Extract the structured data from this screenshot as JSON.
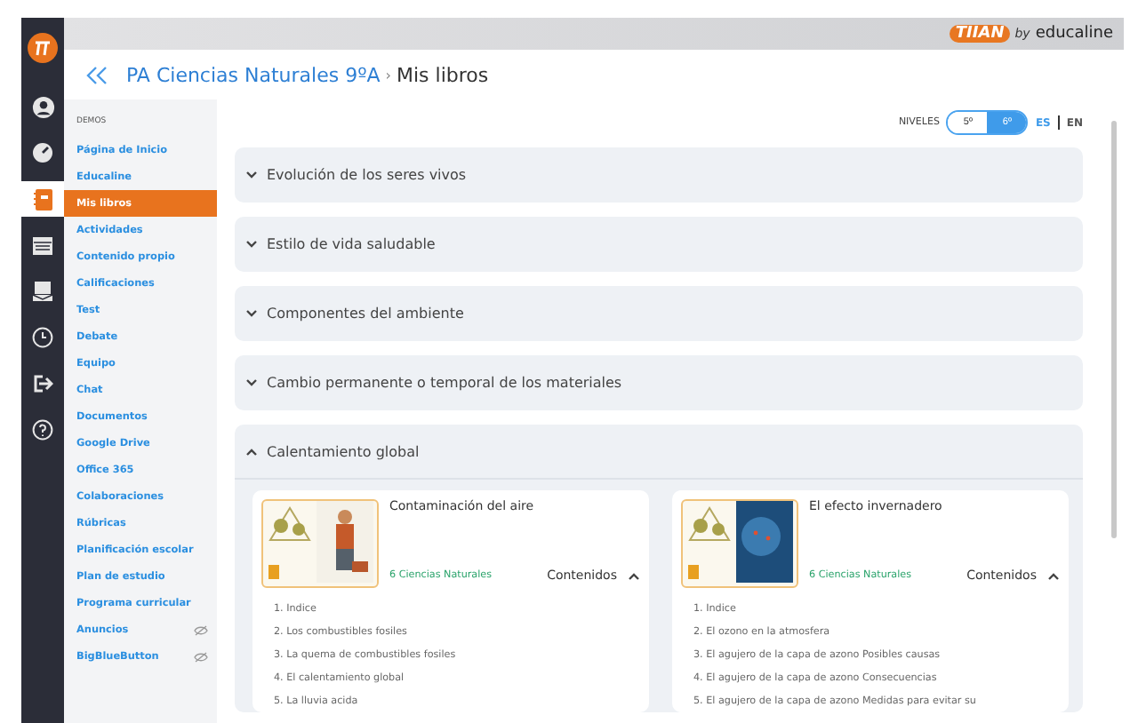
{
  "brand": {
    "name": "TIIAN",
    "by": "by",
    "partner": "educaline"
  },
  "rail": [
    {
      "kind": "logo",
      "selected": false
    },
    {
      "kind": "user",
      "selected": false
    },
    {
      "kind": "gauge",
      "selected": false
    },
    {
      "kind": "book",
      "selected": true
    },
    {
      "kind": "calendar",
      "selected": false
    },
    {
      "kind": "mail",
      "selected": false
    },
    {
      "kind": "clock",
      "selected": false
    },
    {
      "kind": "logout",
      "selected": false
    },
    {
      "kind": "help",
      "selected": false
    }
  ],
  "breadcrumb": {
    "items": [
      "PA Ciencias Naturales 9ºA",
      "Mis libros"
    ],
    "separator": "›"
  },
  "sidebar": {
    "heading": "DEMOS",
    "items": [
      {
        "label": "Página de Inicio",
        "selected": false,
        "hidden": false
      },
      {
        "label": "Educaline",
        "selected": false,
        "hidden": false
      },
      {
        "label": "Mis libros",
        "selected": true,
        "hidden": false
      },
      {
        "label": "Actividades",
        "selected": false,
        "hidden": false
      },
      {
        "label": "Contenido propio",
        "selected": false,
        "hidden": false
      },
      {
        "label": "Calificaciones",
        "selected": false,
        "hidden": false
      },
      {
        "label": "Test",
        "selected": false,
        "hidden": false
      },
      {
        "label": "Debate",
        "selected": false,
        "hidden": false
      },
      {
        "label": "Equipo",
        "selected": false,
        "hidden": false
      },
      {
        "label": "Chat",
        "selected": false,
        "hidden": false
      },
      {
        "label": "Documentos",
        "selected": false,
        "hidden": false
      },
      {
        "label": "Google Drive",
        "selected": false,
        "hidden": false
      },
      {
        "label": "Office 365",
        "selected": false,
        "hidden": false
      },
      {
        "label": "Colaboraciones",
        "selected": false,
        "hidden": false
      },
      {
        "label": "Rúbricas",
        "selected": false,
        "hidden": false
      },
      {
        "label": "Planificación escolar",
        "selected": false,
        "hidden": false
      },
      {
        "label": "Plan de estudio",
        "selected": false,
        "hidden": false
      },
      {
        "label": "Programa curricular",
        "selected": false,
        "hidden": false
      },
      {
        "label": "Anuncios",
        "selected": false,
        "hidden": true
      },
      {
        "label": "BigBlueButton",
        "selected": false,
        "hidden": true
      }
    ]
  },
  "levels": {
    "label": "NIVELES",
    "options": [
      {
        "label": "5º",
        "selected": false
      },
      {
        "label": "6º",
        "selected": true
      }
    ]
  },
  "languages": [
    {
      "label": "ES",
      "selected": true
    },
    {
      "label": "EN",
      "selected": false
    }
  ],
  "units": [
    {
      "title": "Evolución de los seres vivos",
      "expanded": false
    },
    {
      "title": "Estilo de vida saludable",
      "expanded": false
    },
    {
      "title": "Componentes del ambiente",
      "expanded": false
    },
    {
      "title": "Cambio permanente o temporal de los materiales",
      "expanded": false
    },
    {
      "title": "Calentamiento global",
      "expanded": true,
      "books": [
        {
          "title": "Contaminación del aire",
          "subject": "6 Ciencias Naturales",
          "contents_label": "Contenidos",
          "expanded": true,
          "items": [
            "1. Indice",
            "2. Los combustibles fosiles",
            "3. La quema de combustibles fosiles",
            "4. El calentamiento global",
            "5. La lluvia acida"
          ]
        },
        {
          "title": "El efecto invernadero",
          "subject": "6 Ciencias Naturales",
          "contents_label": "Contenidos",
          "expanded": true,
          "items": [
            "1. Indice",
            "2. El ozono en la atmosfera",
            "3. El agujero de la capa de azono Posibles causas",
            "4. El agujero de la capa de azono Consecuencias",
            "5. El agujero de la capa de azono Medidas para evitar su"
          ]
        }
      ]
    }
  ]
}
